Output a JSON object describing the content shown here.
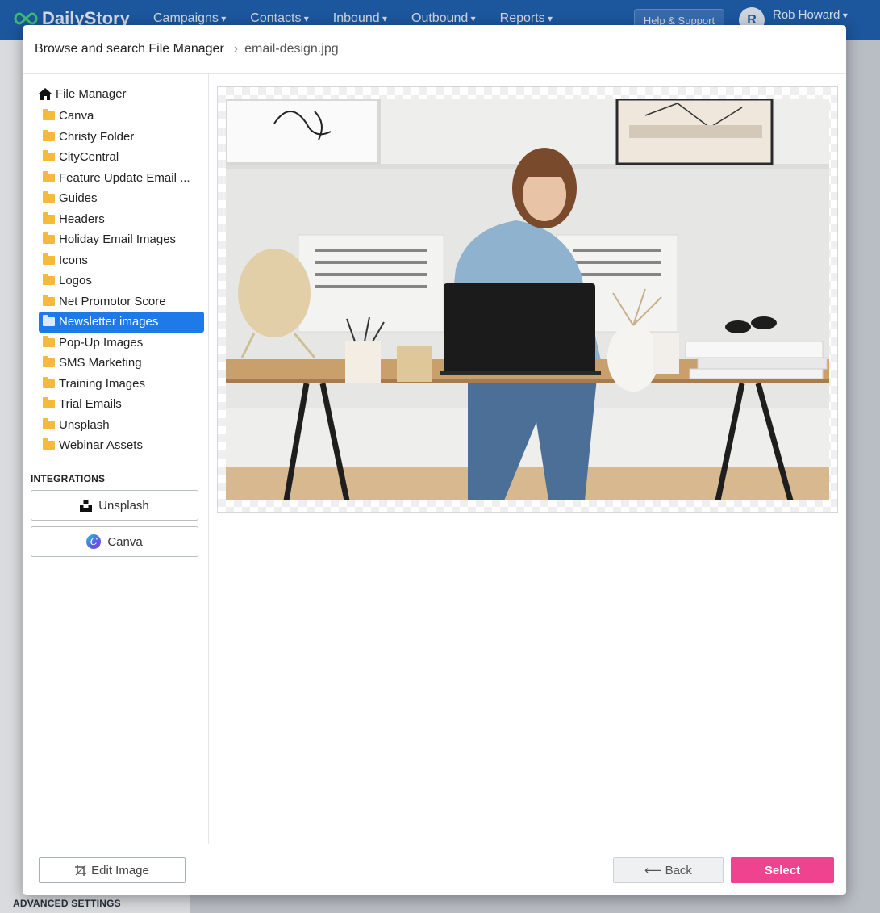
{
  "app": {
    "brand": "DailyStory",
    "nav": [
      "Campaigns",
      "Contacts",
      "Inbound",
      "Outbound",
      "Reports"
    ],
    "help_label": "Help & Support",
    "user_initial": "R",
    "user_name": "Rob Howard",
    "sidebar_footer_label": "ADVANCED SETTINGS"
  },
  "modal": {
    "breadcrumb_root": "Browse and search File Manager",
    "breadcrumb_file": "email-design.jpg",
    "tree_root": "File Manager",
    "folders": [
      "Canva",
      "Christy Folder",
      "CityCentral",
      "Feature Update Email ...",
      "Guides",
      "Headers",
      "Holiday Email Images",
      "Icons",
      "Logos",
      "Net Promotor Score",
      "Newsletter images",
      "Pop-Up Images",
      "SMS Marketing",
      "Training Images",
      "Trial Emails",
      "Unsplash",
      "Webinar Assets"
    ],
    "active_folder": "Newsletter images",
    "integrations_title": "INTEGRATIONS",
    "integrations": {
      "unsplash": "Unsplash",
      "canva": "Canva"
    },
    "icons": {
      "home": "home-icon",
      "folder": "folder-icon",
      "unsplash": "unsplash-icon",
      "canva": "canva-icon",
      "edit": "crop-icon",
      "back": "arrow-left-icon"
    },
    "preview_image": "photo of a woman at a wooden desk with a laptop, woven lamp, pencil cups and stacked magazines",
    "footer": {
      "edit_label": "Edit Image",
      "back_label": "Back",
      "select_label": "Select"
    }
  },
  "colors": {
    "topbar": "#1f5eab",
    "active_folder": "#1e7ae8",
    "select_button": "#f0438f",
    "folder_icon": "#f6b93b"
  }
}
